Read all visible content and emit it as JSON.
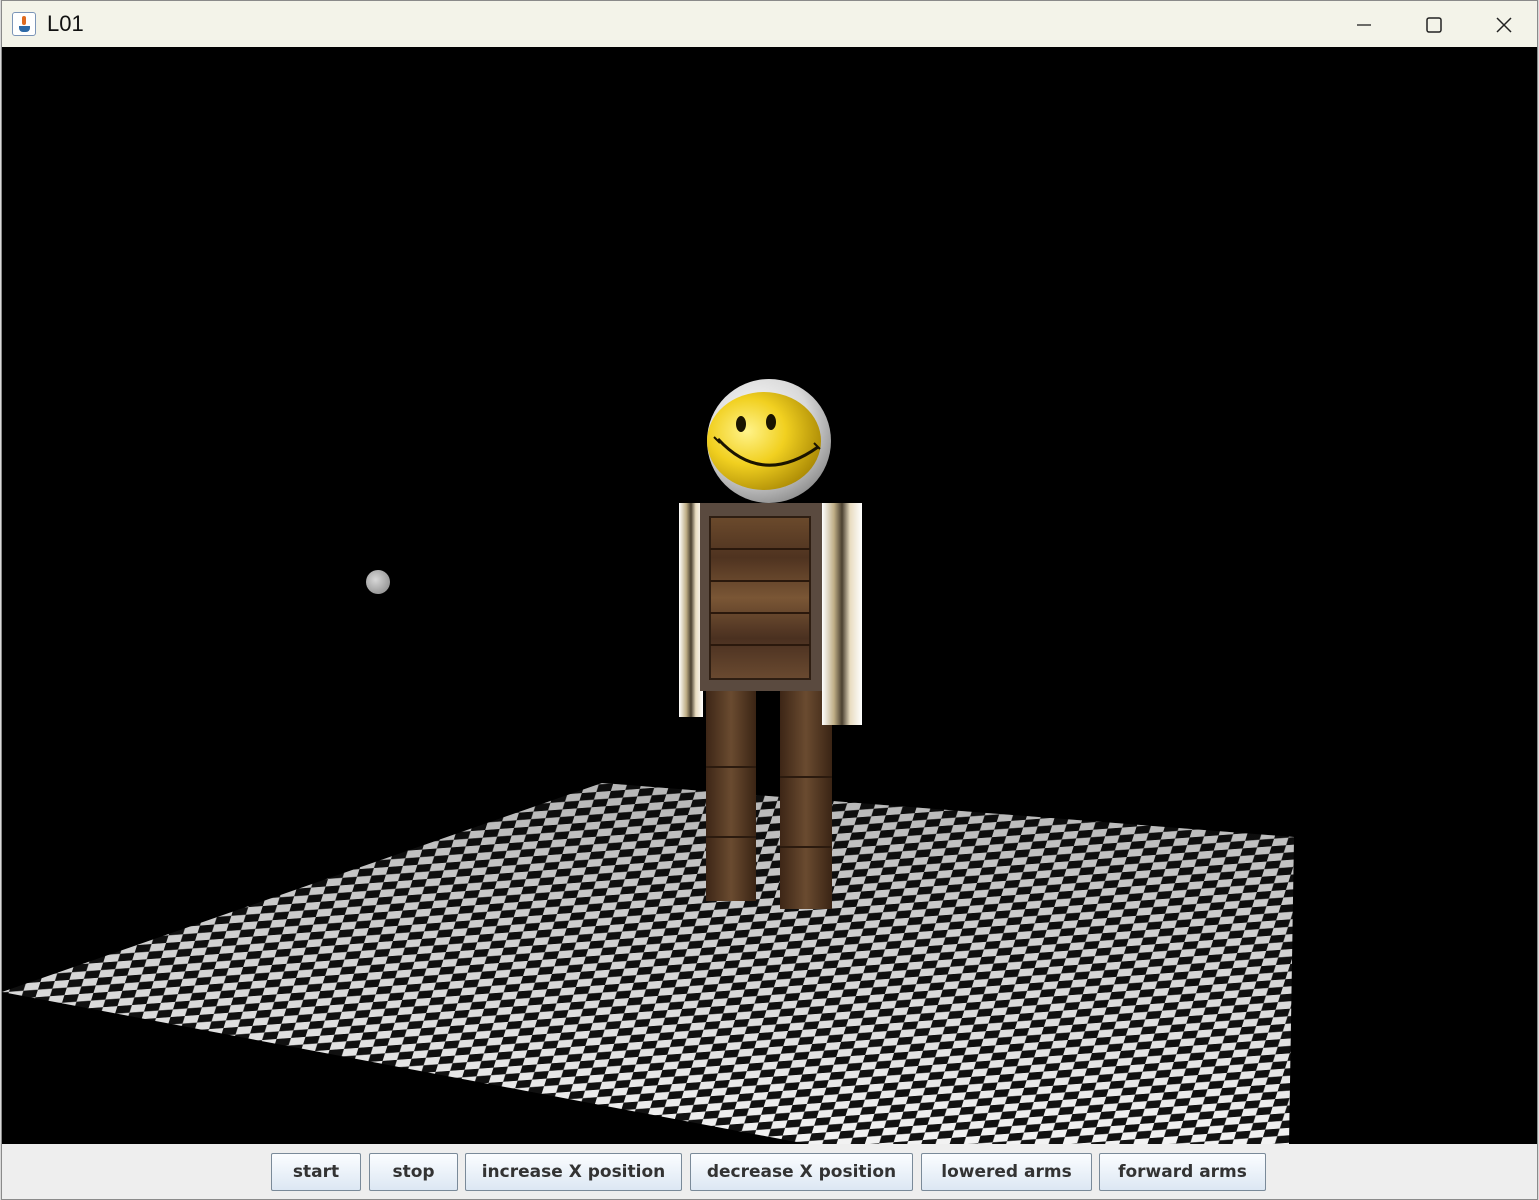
{
  "window": {
    "title": "L01",
    "app_icon": "java-cup-icon",
    "controls": [
      "minimize-icon",
      "maximize-icon",
      "close-icon"
    ]
  },
  "scene": {
    "background_color": "#000000",
    "objects": [
      "checkerboard-floor",
      "robot-figure",
      "smiley-face-head",
      "light-sphere"
    ]
  },
  "buttons": {
    "start": "start",
    "stop": "stop",
    "increase_x": "increase X position",
    "decrease_x": "decrease X position",
    "lowered_arms": "lowered arms",
    "forward_arms": "forward arms"
  },
  "colors": {
    "button_gradient_top": "#fbfdff",
    "button_gradient_bottom": "#dce7f3",
    "titlebar": "#f3f3e9"
  }
}
